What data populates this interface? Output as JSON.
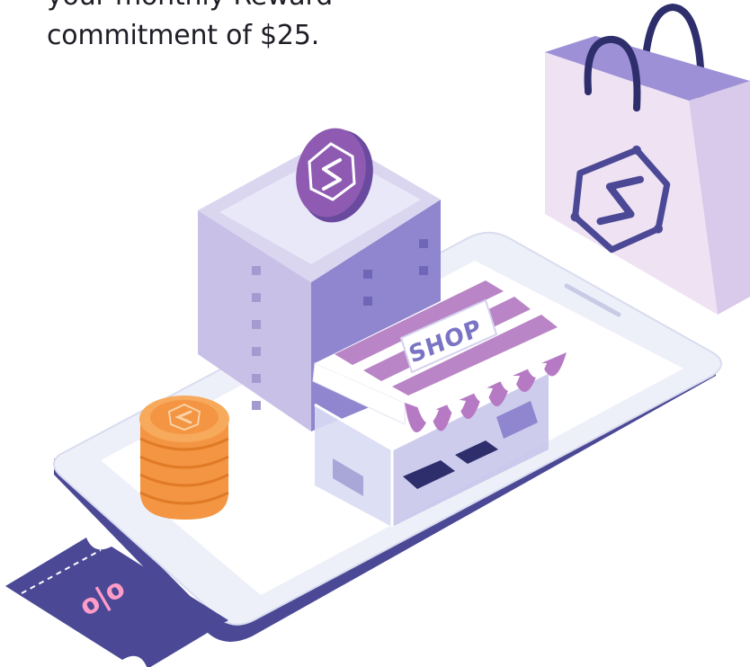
{
  "caption": {
    "line1": "your monthly Reward",
    "line2": "commitment of $25."
  },
  "illustration": {
    "shop_sign": "SHOP",
    "coupon_symbol": "o|o",
    "colors": {
      "text": "#1e1e26",
      "purple_dark": "#4b4896",
      "purple_mid": "#7a74c4",
      "lavender": "#c9c2ea",
      "pink": "#d78fc7",
      "orange": "#f39542",
      "phone_white": "#f4f5fb"
    },
    "icons": [
      "phone-icon",
      "office-building-icon",
      "shop-storefront-icon",
      "coin-stack-icon",
      "discount-coupon-icon",
      "shopping-bag-icon",
      "s-logo-coin-icon"
    ]
  }
}
